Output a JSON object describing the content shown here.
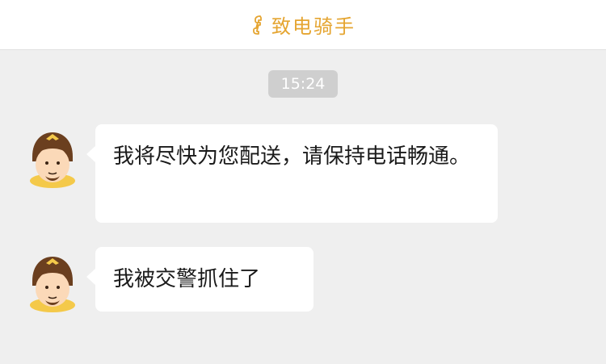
{
  "header": {
    "title": "致电骑手",
    "icon": "phone-icon",
    "accent_color": "#e5a531"
  },
  "chat": {
    "time": "15:24",
    "messages": [
      {
        "sender": "rider",
        "avatar": "rider-avatar-icon",
        "text": "我将尽快为您配送，请保持电话畅通。"
      },
      {
        "sender": "rider",
        "avatar": "rider-avatar-icon",
        "text": "我被交警抓住了"
      }
    ]
  }
}
